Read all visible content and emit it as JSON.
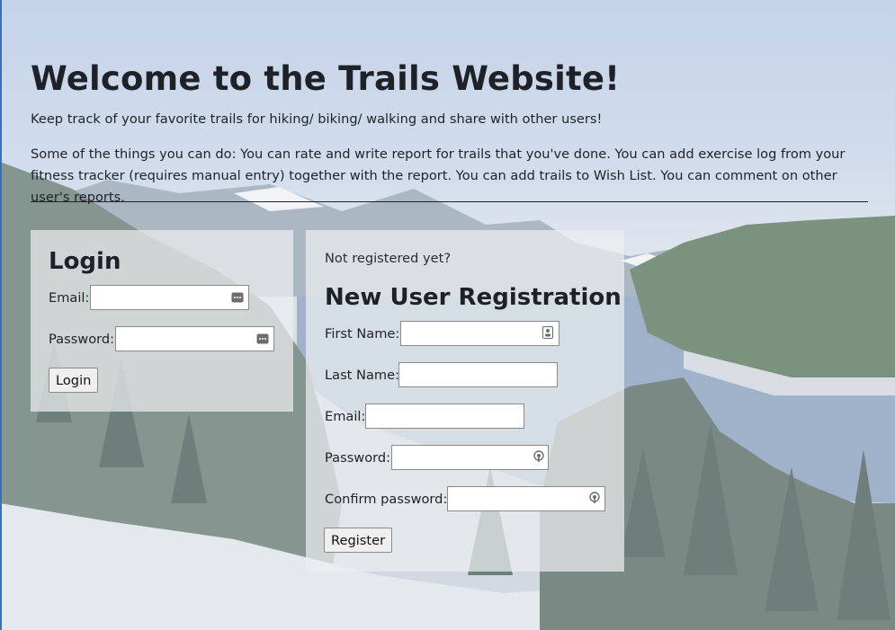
{
  "header": {
    "title": "Welcome to the Trails Website!",
    "tagline": "Keep track of your favorite trails for hiking/ biking/ walking and share with other users!",
    "description": "Some of the things you can do: You can rate and write report for trails that you've done. You can add exercise log from your fitness tracker (requires manual entry) together with the report. You can add trails to Wish List. You can comment on other user's reports."
  },
  "login": {
    "title": "Login",
    "email_label": "Email:",
    "email_value": "",
    "password_label": "Password:",
    "password_value": "",
    "submit_label": "Login",
    "field_icon": "password-manager-icon"
  },
  "registration": {
    "prompt": "Not registered yet?",
    "title": "New User Registration",
    "first_name_label": "First Name:",
    "first_name_value": "",
    "last_name_label": "Last Name:",
    "last_name_value": "",
    "email_label": "Email:",
    "email_value": "",
    "password_label": "Password:",
    "password_value": "",
    "confirm_password_label": "Confirm password:",
    "confirm_password_value": "",
    "submit_label": "Register",
    "first_name_icon": "contact-card-icon",
    "password_icon": "key-icon"
  },
  "colors": {
    "panel_bg": "#eceef0",
    "text": "#1e2228"
  }
}
